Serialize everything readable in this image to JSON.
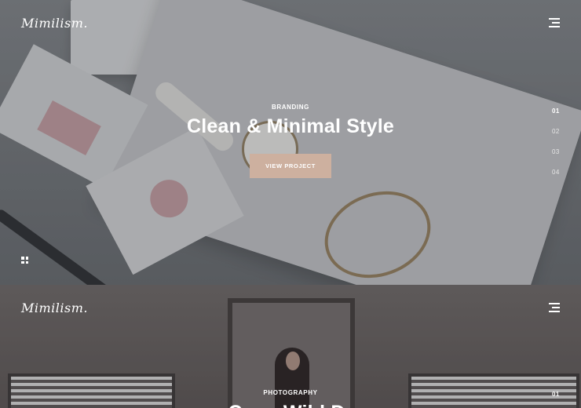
{
  "brand": {
    "logo": "Mimilism."
  },
  "slides": [
    {
      "category": "BRANDING",
      "title": "Clean & Minimal Style",
      "button_label": "VIEW PROJECT",
      "pager": [
        "01",
        "02",
        "03",
        "04"
      ],
      "active_page": "01"
    },
    {
      "category": "PHOTOGRAPHY",
      "title_partial": "Crow Wild Dr",
      "pager": [
        "01"
      ],
      "active_page": "01"
    }
  ],
  "icons": {
    "menu": "hamburger-menu-icon",
    "grid": "grid-icon"
  },
  "colors": {
    "accent_button": "#cdb09f",
    "text": "#ffffff"
  }
}
